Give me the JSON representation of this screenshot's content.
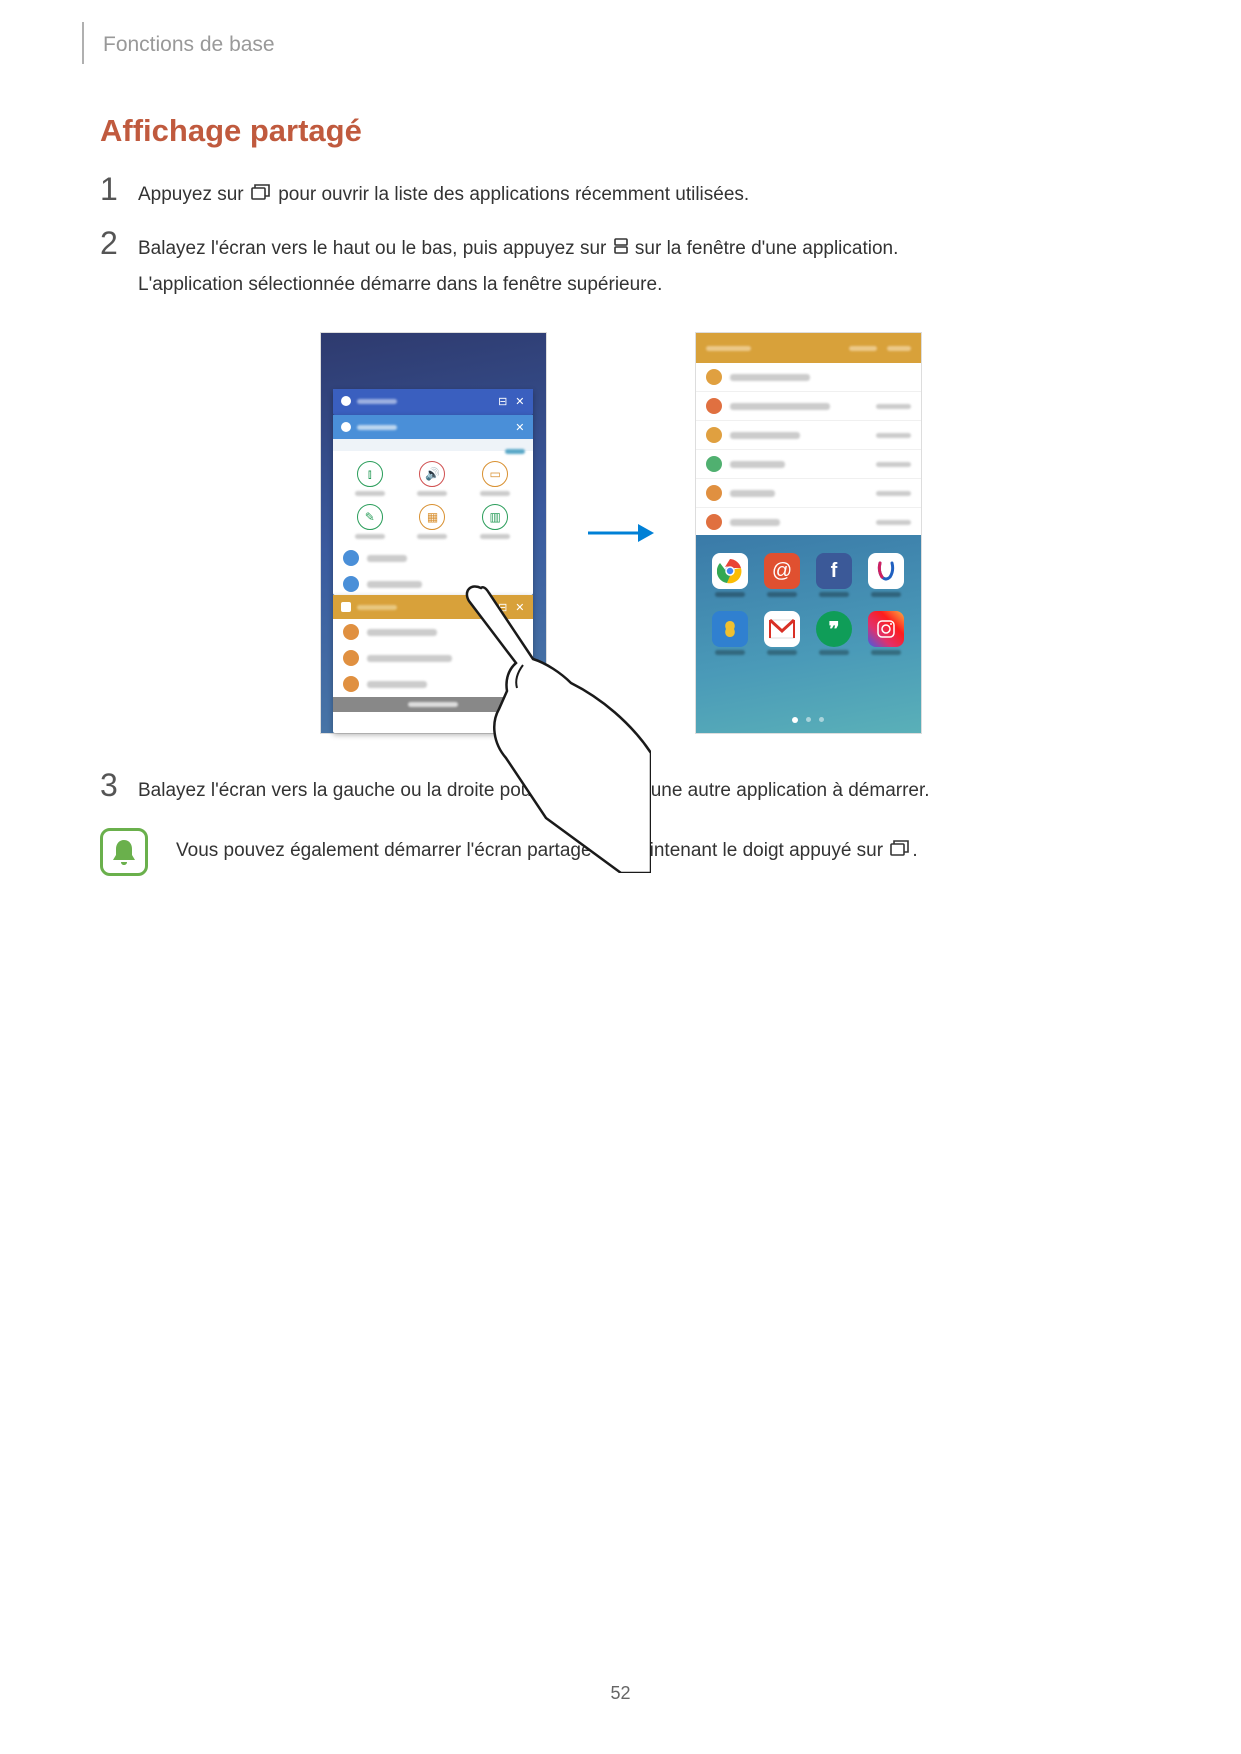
{
  "breadcrumb": "Fonctions de base",
  "heading": "Affichage partagé",
  "steps": {
    "s1": {
      "num": "1",
      "a": "Appuyez sur ",
      "b": " pour ouvrir la liste des applications récemment utilisées."
    },
    "s2": {
      "num": "2",
      "a": "Balayez l'écran vers le haut ou le bas, puis appuyez sur ",
      "b": " sur la fenêtre d'une application.",
      "c": "L'application sélectionnée démarre dans la fenêtre supérieure."
    },
    "s3": {
      "num": "3",
      "a": "Balayez l'écran vers la gauche ou la droite pour sélectionner une autre application à démarrer."
    }
  },
  "note": {
    "a": "Vous pouvez également démarrer l'écran partagé en maintenant le doigt appuyé sur ",
    "b": "."
  },
  "pageNumber": "52",
  "icons": {
    "recent": "recent-apps-icon",
    "split": "split-view-icon",
    "bell": "bell-icon"
  }
}
